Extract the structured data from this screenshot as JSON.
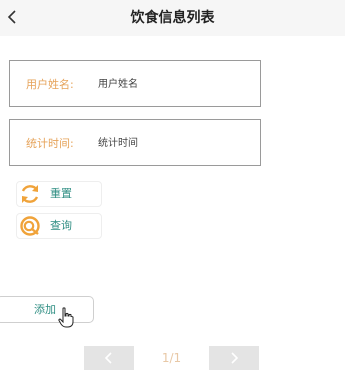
{
  "header": {
    "title": "饮食信息列表",
    "back_icon": "chevron-left-icon"
  },
  "form": {
    "username": {
      "label": "用户姓名:",
      "placeholder": "用户姓名"
    },
    "time": {
      "label": "统计时间:",
      "placeholder": "统计时间"
    }
  },
  "actions": {
    "reset": {
      "label": "重置",
      "icon": "refresh-icon"
    },
    "search": {
      "label": "查询",
      "icon": "search-icon"
    }
  },
  "add": {
    "label": "添加"
  },
  "pagination": {
    "indicator": "1/1",
    "prev_icon": "chevron-left-icon",
    "next_icon": "chevron-right-icon"
  },
  "colors": {
    "accent": "#e6a35a",
    "teal": "#2f8e83",
    "pager_bg": "#e4e4e4"
  }
}
